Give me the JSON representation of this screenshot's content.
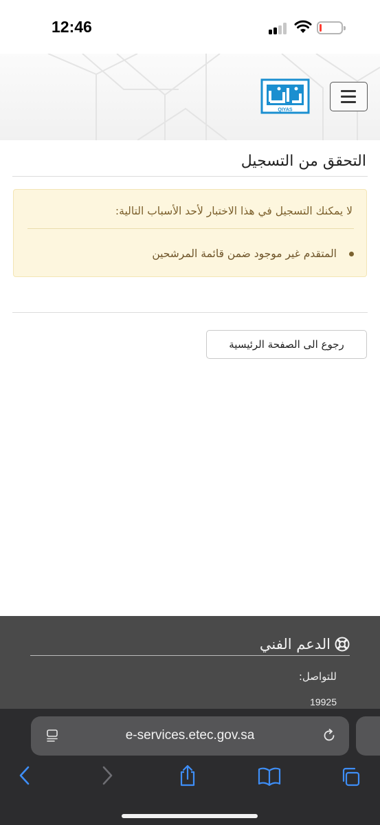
{
  "status_bar": {
    "time": "12:46",
    "battery_level": 0.1,
    "battery_color": "#ff3b30"
  },
  "header": {
    "logo_text": "QIYAS",
    "logo_color": "#1b8fd0",
    "menu_icon": "hamburger-menu-icon"
  },
  "main": {
    "title": "التحقق من التسجيل",
    "alert": {
      "heading": "لا يمكنك التسجيل في هذا الاختبار لأحد الأسباب التالية:",
      "items": [
        "المتقدم غير موجود ضمن قائمة المرشحين"
      ],
      "background": "#fdf6de",
      "text_color": "#7b5f2b"
    },
    "home_button_label": "رجوع الى الصفحة الرئيسية"
  },
  "footer": {
    "support_icon": "lifebuoy-icon",
    "support_title": "الدعم الفني",
    "contact_label": "للتواصل:",
    "contact_number": "19925",
    "background": "#4a4a4a"
  },
  "browser": {
    "url": "e-services.etec.gov.sa",
    "accent": "#3e8ef7",
    "toolbar_icons": [
      "back-icon",
      "forward-icon",
      "share-icon",
      "bookmarks-icon",
      "tabs-icon"
    ]
  }
}
